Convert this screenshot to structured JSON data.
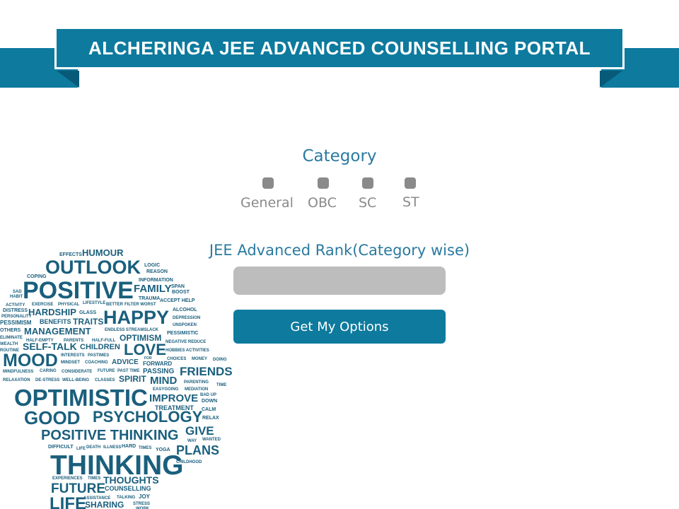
{
  "header": {
    "title": "ALCHERINGA JEE ADVANCED COUNSELLING PORTAL"
  },
  "form": {
    "category_label": "Category",
    "categories": [
      "General",
      "OBC",
      "SC",
      "ST"
    ],
    "rank_label": "JEE Advanced Rank(Category wise)",
    "rank_value": "",
    "submit_label": "Get My Options"
  },
  "colors": {
    "primary": "#0d7a9e",
    "text_accent": "#2a7aa0",
    "input_bg": "#bdbdbd",
    "word_cloud": "#1a5f7d"
  },
  "word_cloud": {
    "words": [
      "EFFECTS",
      "HUMOUR",
      "OUTLOOK",
      "LOGIC",
      "COPING",
      "REASON",
      "POSITIVE",
      "FAMILY",
      "INFORMATION",
      "SPAN",
      "BOOST",
      "TRAUMA",
      "ACTIVITY",
      "EXERCISE",
      "PHYSICAL",
      "LIFESTYLE",
      "BETTER",
      "ACCEPT",
      "HELP",
      "DISTRESS",
      "HARDSHIP",
      "GLASS",
      "HAPPY",
      "ALCOHOL",
      "PESSIMISM",
      "BENEFITS",
      "TRAITS",
      "DEPRESSION",
      "OTHERS",
      "MANAGEMENT",
      "ENDLESS",
      "STREAMSLACK",
      "PESSIMISTIC",
      "ELIMINATE",
      "HALF-EMPTY",
      "PARENTS",
      "HALF-FULL",
      "OPTIMISM",
      "NEGATIVE",
      "REDUCE",
      "WEALTH",
      "SELF-TALK",
      "CHILDREN",
      "LOVE",
      "HOBBIES",
      "ACTIVITIES",
      "MOOD",
      "INTERESTS",
      "PASTIMES",
      "CHOICES",
      "MONEY",
      "DOING",
      "MINDSET",
      "COACHING",
      "ADVICE",
      "FORWARD",
      "MINDFULNESS",
      "CARING",
      "CONSIDERATE",
      "FUTURE",
      "PAST TIME",
      "PASSING",
      "FRIENDS",
      "RELAXATION",
      "DE-STRESS",
      "WELL-BEING",
      "CLASSES",
      "SPIRIT",
      "MIND",
      "PARENTING",
      "TIME",
      "EASYGOING",
      "MEDIATION",
      "OPTIMISTIC",
      "IMPROVE",
      "BAD",
      "UP",
      "DOWN",
      "TREATMENT",
      "CALM",
      "GOOD",
      "PSYCHOLOGY",
      "RELAX",
      "POSITIVE THINKING",
      "GIVE",
      "WAY",
      "DIFFICULT",
      "LIFE",
      "DEATH",
      "ILLNESS",
      "HARD",
      "TIMES",
      "YOGA",
      "PLANS",
      "THINKING",
      "CHILDHOOD",
      "EXPERIENCES",
      "THOUGHTS",
      "FUTURE",
      "COUNSELLING",
      "ASSISTANCE",
      "TALKING",
      "JOY",
      "STRESS",
      "WORK",
      "LIFE",
      "SHARING"
    ]
  }
}
